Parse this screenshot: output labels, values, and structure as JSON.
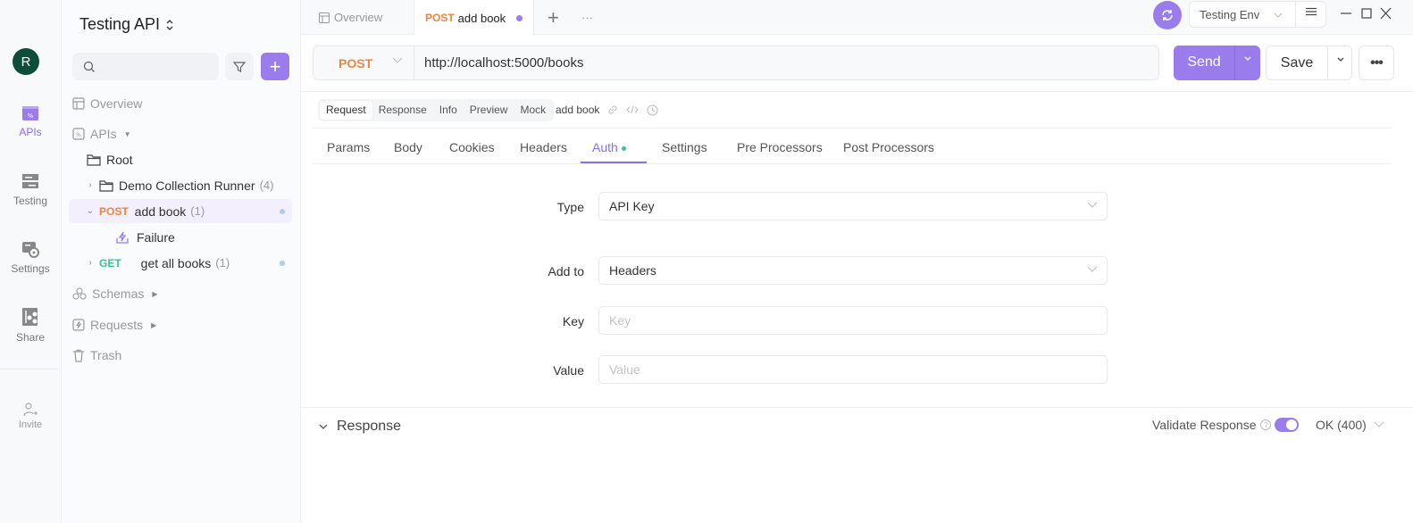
{
  "rail": {
    "avatar_initial": "R",
    "items": [
      {
        "label": "APIs",
        "icon": "apis-icon",
        "active": true
      },
      {
        "label": "Testing",
        "icon": "testing-icon",
        "active": false
      },
      {
        "label": "Settings",
        "icon": "settings-icon",
        "active": false
      },
      {
        "label": "Share",
        "icon": "share-icon",
        "active": false
      }
    ],
    "invite_label": "Invite"
  },
  "sidebar": {
    "project_title": "Testing API",
    "search_placeholder": "",
    "overview_label": "Overview",
    "apis_label": "APIs",
    "root_label": "Root",
    "tree": [
      {
        "type": "folder",
        "label": "Demo Collection Runner",
        "count": "(4)"
      },
      {
        "type": "endpoint",
        "method": "POST",
        "label": "add book",
        "count": "(1)",
        "selected": true,
        "expanded": true
      },
      {
        "type": "case",
        "label": "Failure"
      },
      {
        "type": "endpoint",
        "method": "GET",
        "label": "get all books",
        "count": "(1)",
        "selected": false,
        "expanded": false
      }
    ],
    "schemas_label": "Schemas",
    "requests_label": "Requests",
    "trash_label": "Trash"
  },
  "tabs": {
    "overview_label": "Overview",
    "active_method": "POST",
    "active_label": "add book"
  },
  "environment": {
    "name": "Testing Env"
  },
  "request": {
    "method": "POST",
    "url": "http://localhost:5000/books",
    "send_label": "Send",
    "save_label": "Save"
  },
  "view_tabs": {
    "items": [
      "Request",
      "Response",
      "Info",
      "Preview",
      "Mock"
    ],
    "active": "Request",
    "endpoint_name": "add book"
  },
  "request_tabs": {
    "items": [
      "Params",
      "Body",
      "Cookies",
      "Headers",
      "Auth",
      "Settings",
      "Pre Processors",
      "Post Processors"
    ],
    "active": "Auth"
  },
  "auth": {
    "type_label": "Type",
    "type_value": "API Key",
    "add_to_label": "Add to",
    "add_to_value": "Headers",
    "key_label": "Key",
    "key_placeholder": "Key",
    "value_label": "Value",
    "value_placeholder": "Value"
  },
  "response": {
    "title": "Response",
    "validate_label": "Validate Response",
    "validate_enabled": true,
    "status_option": "OK (400)"
  },
  "colors": {
    "accent": "#9a7cec",
    "post": "#f0843a",
    "get": "#3bc38f"
  }
}
